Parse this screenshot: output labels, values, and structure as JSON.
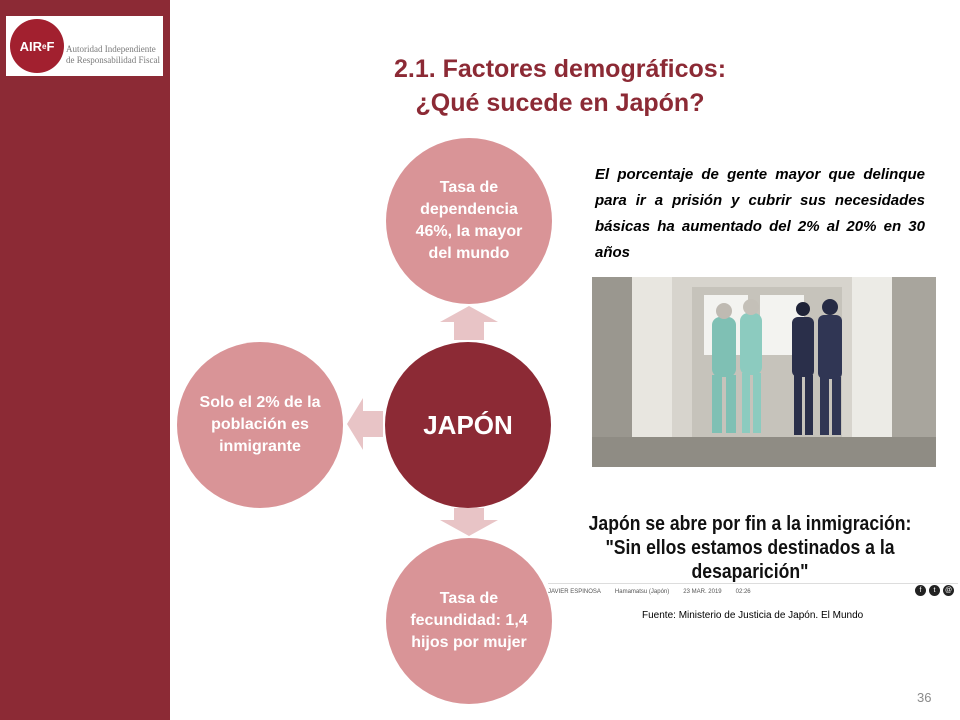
{
  "logo": {
    "mark": "AIReF",
    "mark_main": "AIR",
    "mark_sup": "e",
    "mark_end": "F",
    "line1": "Autoridad Independiente",
    "line2": "de Responsabilidad Fiscal"
  },
  "title": {
    "line1": "2.1. Factores demográficos:",
    "line2": "¿Qué sucede en Japón?"
  },
  "diagram": {
    "center": "JAPÓN",
    "top": "Tasa de dependencia 46%, la mayor del mundo",
    "left": "Solo el 2% de la población es inmigrante",
    "bottom": "Tasa de fecundidad: 1,4 hijos por mujer"
  },
  "quote": "El porcentaje de gente mayor que delinque para ir a prisión y cubrir sus necesidades básicas ha aumentado del 2% al 20% en 30 años",
  "news": {
    "headline": "Japón se abre por fin a la inmigración: \"Sin ellos estamos destinados a la desaparición\"",
    "author": "JAVIER ESPINOSA",
    "location": "Hamamatsu (Japón)",
    "date": "23 MAR. 2019",
    "time": "02:26"
  },
  "source": "Fuente: Ministerio de Justicia de Japón. El Mundo",
  "page_number": "36",
  "colors": {
    "brand": "#8c2a35",
    "circle_light": "#d99497",
    "arrow": "#e8c4c6"
  }
}
